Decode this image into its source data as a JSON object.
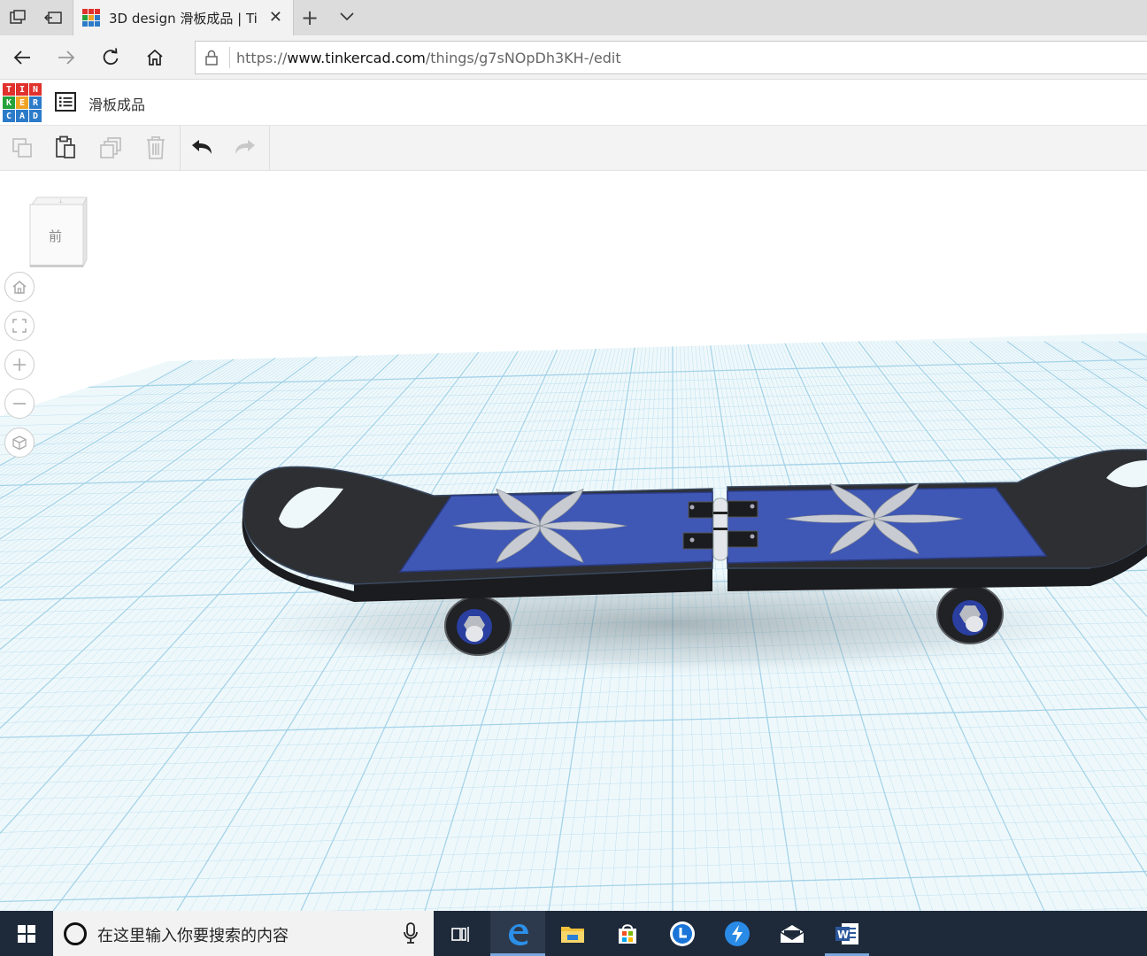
{
  "browser": {
    "tab_title": "3D design 滑板成品 | Ti",
    "url_prefix": "https://",
    "url_host": "www.tinkercad.com",
    "url_path": "/things/g7sNOpDh3KH-/edit"
  },
  "app": {
    "logo_letters": [
      "T",
      "I",
      "N",
      "K",
      "E",
      "R",
      "C",
      "A",
      "D"
    ],
    "logo_colors": [
      "#e0312c",
      "#e0312c",
      "#e0312c",
      "#26a23a",
      "#f0a323",
      "#2c7bc9",
      "#2c7bc9",
      "#2c7bc9",
      "#2c7bc9"
    ],
    "design_name": "滑板成品"
  },
  "toolbar": {
    "tools": [
      "copy-icon",
      "paste-icon",
      "duplicate-icon",
      "delete-icon",
      "undo-icon",
      "redo-icon"
    ]
  },
  "viewcube": {
    "face_label": "前"
  },
  "view_controls": [
    "home-view-icon",
    "fit-view-icon",
    "zoom-in-icon",
    "zoom-out-icon",
    "perspective-icon"
  ],
  "taskbar": {
    "search_placeholder": "在这里输入你要搜索的内容",
    "apps": [
      "task-view-icon",
      "edge-icon",
      "file-explorer-icon",
      "store-icon",
      "clock-app-icon",
      "sync-app-icon",
      "mail-icon",
      "word-icon"
    ]
  },
  "colors": {
    "grid_line": "#9fd0e6",
    "board_deck": "#2d2f33",
    "grip": "#3f57b5",
    "flower": "#c8ccd2"
  }
}
